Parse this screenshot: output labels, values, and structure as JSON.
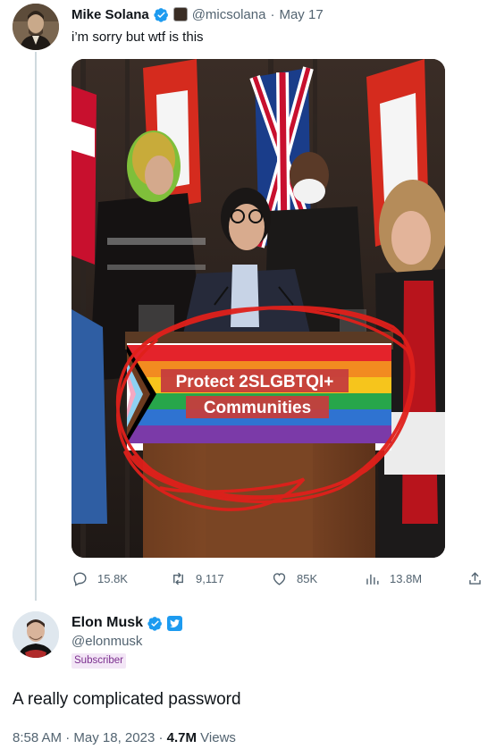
{
  "quoted_tweet": {
    "author_name": "Mike Solana",
    "handle": "@micsolana",
    "separator": "·",
    "date": "May 17",
    "text": "i’m sorry but wtf is this",
    "media": {
      "podium_banner_line1": "Protect 2SLGBTQI+",
      "podium_banner_line2": "Communities"
    },
    "stats": {
      "replies": "15.8K",
      "retweets": "9,117",
      "likes": "85K",
      "views": "13.8M"
    }
  },
  "main_tweet": {
    "author_name": "Elon Musk",
    "handle": "@elonmusk",
    "badge": "Subscriber",
    "text": "A really complicated password",
    "time": "8:58 AM",
    "date": "May 18, 2023",
    "views_count": "4.7M",
    "views_label": "Views"
  },
  "colors": {
    "verified_blue": "#1d9bf0",
    "muted_text": "#536471",
    "annotation_red": "#e0201b"
  },
  "icons": [
    "verified-badge-icon",
    "reply-icon",
    "retweet-icon",
    "like-icon",
    "views-icon",
    "share-icon",
    "twitter-bird-icon"
  ]
}
